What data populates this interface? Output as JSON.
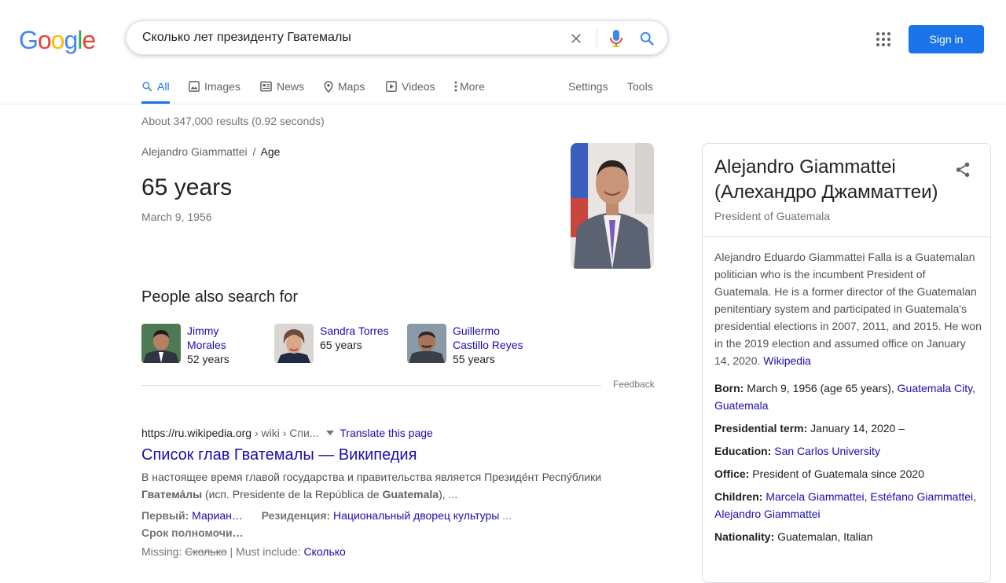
{
  "header": {
    "logo_letters": [
      "G",
      "o",
      "o",
      "g",
      "l",
      "e"
    ],
    "logo_colors": [
      "#4285f4",
      "#ea4335",
      "#fbbc05",
      "#4285f4",
      "#34a853",
      "#ea4335"
    ],
    "query": "Сколько лет президенту Гватемалы",
    "sign_in": "Sign in"
  },
  "tabs": {
    "all": "All",
    "images": "Images",
    "news": "News",
    "maps": "Maps",
    "videos": "Videos",
    "more": "More",
    "settings": "Settings",
    "tools": "Tools"
  },
  "stats": "About 347,000 results (0.92 seconds)",
  "answer": {
    "breadcrumb_entity": "Alejandro Giammattei",
    "breadcrumb_sep": "/",
    "breadcrumb_attr": "Age",
    "value": "65 years",
    "date": "March 9, 1956"
  },
  "people_also_search": {
    "title": "People also search for",
    "items": [
      {
        "name1": "Jimmy",
        "name2": "Morales",
        "age": "52 years"
      },
      {
        "name1": "Sandra Torres",
        "name2": "",
        "age": "65 years"
      },
      {
        "name1": "Guillermo",
        "name2": "Castillo Reyes",
        "age": "55 years"
      }
    ],
    "feedback": "Feedback"
  },
  "result": {
    "url_host": "https://ru.wikipedia.org",
    "url_path": " › wiki › Спи...",
    "translate": "Translate this page",
    "title": "Список глав Гватемалы — Википедия",
    "snippet_line1": "В настоящее время главой государства и правительства является Президе́нт Респу́блики",
    "snippet_bold1": "Гватема́лы",
    "snippet_mid": " (исп. Presidente de la República de ",
    "snippet_bold2": "Guatemala",
    "snippet_end": "), ...",
    "row1_label1": "Первый: ",
    "row1_val1": "Мариан…",
    "row1_label2": "Резиденция: ",
    "row1_val2": "Национальный дворец культуры",
    "row1_tail": " ...",
    "row2_label": "Срок полномочи…",
    "missing_label": "Missing: ",
    "missing_word": "Сколько",
    "must_include_label": " | Must include: ",
    "must_include_word": "Сколько"
  },
  "knowledge_panel": {
    "title": "Alejandro Giammattei (Алехандро Джамматтеи)",
    "subtitle": "President of Guatemala",
    "description": "Alejandro Eduardo Giammattei Falla is a Guatemalan politician who is the incumbent President of Guatemala. He is a former director of the Guatemalan penitentiary system and participated in Guatemala's presidential elections in 2007, 2011, and 2015. He won in the 2019 election and assumed office on January 14, 2020.",
    "description_source": "Wikipedia",
    "born_label": "Born:",
    "born_value": " March 9, 1956 (age 65 years), ",
    "born_link": "Guatemala City, Guatemala",
    "term_label": "Presidential term:",
    "term_value": " January 14, 2020 –",
    "education_label": "Education:",
    "education_link": "San Carlos University",
    "office_label": "Office:",
    "office_value": " President of Guatemala since 2020",
    "children_label": "Children:",
    "children_link1": "Marcela Giammattei",
    "children_sep1": ", ",
    "children_link2": "Estéfano Giammattei",
    "children_sep2": ", ",
    "children_link3": "Alejandro Giammattei",
    "nationality_label": "Nationality:",
    "nationality_value": " Guatemalan, Italian"
  }
}
